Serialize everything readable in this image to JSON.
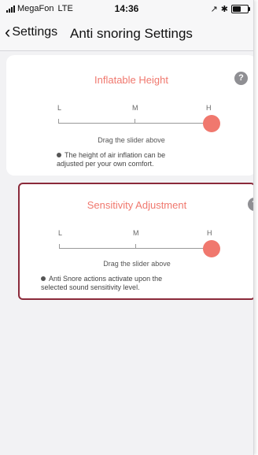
{
  "status": {
    "carrier": "MegaFon",
    "network": "LTE",
    "time": "14:36",
    "right_icons": "location-arrow, bluetooth, battery",
    "battery_level": 0.6
  },
  "nav": {
    "back_label": "Settings",
    "title": "Anti snoring Settings"
  },
  "cards": [
    {
      "title": "Inflatable Height",
      "help": "?",
      "scale": [
        "L",
        "M",
        "H"
      ],
      "slider_value": "H",
      "hint": "Drag the slider above",
      "note_line1": "The height of air inflation can be",
      "note_line2": "adjusted per your own comfort."
    },
    {
      "title": "Sensitivity Adjustment",
      "help": "?",
      "scale": [
        "L",
        "M",
        "H"
      ],
      "slider_value": "H",
      "hint": "Drag the slider above",
      "note_line1": "Anti Snore actions activate upon the",
      "note_line2": "selected sound sensitivity level."
    }
  ],
  "colors": {
    "accent": "#f0786e",
    "highlight_border": "#8b2a3a",
    "background": "#f2f2f4"
  }
}
